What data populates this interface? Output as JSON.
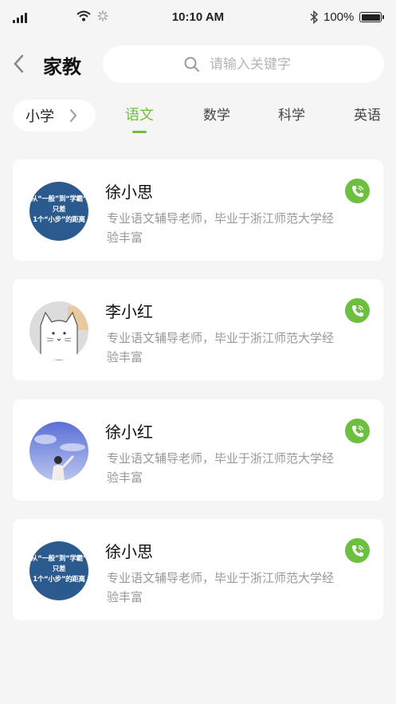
{
  "status_bar": {
    "time": "10:10 AM",
    "battery": "100%"
  },
  "header": {
    "title": "家教",
    "search_placeholder": "请输入关键字"
  },
  "filter": {
    "grade": "小学"
  },
  "tabs": [
    {
      "label": "语文",
      "active": true
    },
    {
      "label": "数学",
      "active": false
    },
    {
      "label": "科学",
      "active": false
    },
    {
      "label": "英语",
      "active": false
    }
  ],
  "teachers": [
    {
      "name": "徐小思",
      "desc": "专业语文辅导老师，毕业于浙江师范大学经验丰富",
      "avatar": "poster",
      "avatar_lines": [
        "从“一般”到“学霸”",
        "只差",
        "1个“小步”的距离"
      ]
    },
    {
      "name": "李小红",
      "desc": "专业语文辅导老师，毕业于浙江师范大学经验丰富",
      "avatar": "cat-sketch"
    },
    {
      "name": "徐小红",
      "desc": "专业语文辅导老师，毕业于浙江师范大学经验丰富",
      "avatar": "sky-photo"
    },
    {
      "name": "徐小思",
      "desc": "专业语文辅导老师，毕业于浙江师范大学经验丰富",
      "avatar": "poster",
      "avatar_lines": [
        "从“一般”到“学霸”",
        "只差",
        "1个“小步”的距离"
      ]
    }
  ],
  "colors": {
    "accent": "#6cbf3f",
    "background": "#f5f5f5",
    "card": "#ffffff",
    "muted_text": "#999999"
  },
  "icons": {
    "back": "chevron-left-icon",
    "search": "search-icon",
    "filter_arrow": "chevron-right-icon",
    "call": "phone-icon"
  }
}
